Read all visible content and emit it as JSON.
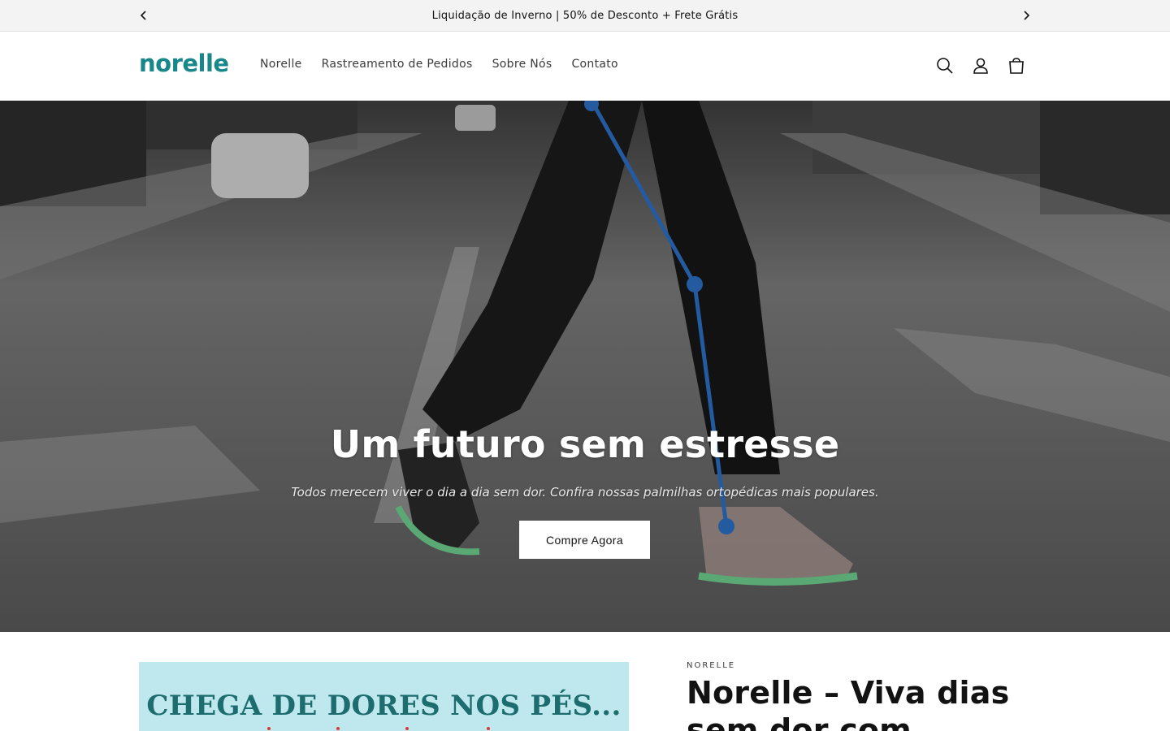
{
  "announcement": {
    "text": "Liquidação de Inverno | 50% de Desconto + Frete Grátis",
    "prev_icon": "chevron-left-icon",
    "next_icon": "chevron-right-icon"
  },
  "header": {
    "logo": "norelle",
    "brand_color": "#17878a",
    "nav": [
      {
        "label": "Norelle"
      },
      {
        "label": "Rastreamento de Pedidos"
      },
      {
        "label": "Sobre Nós"
      },
      {
        "label": "Contato"
      }
    ],
    "icons": [
      "search-icon",
      "account-icon",
      "cart-icon"
    ]
  },
  "hero": {
    "title": "Um futuro sem estresse",
    "subtitle": "Todos merecem viver o dia a dia sem dor. Confira nossas palmilhas ortopédicas mais populares.",
    "button_label": "Compre Agora"
  },
  "product": {
    "image_text": "CHEGA DE DORES NOS PÉS...",
    "vendor": "NORELLE",
    "title": "Norelle – Viva dias sem dor com"
  }
}
